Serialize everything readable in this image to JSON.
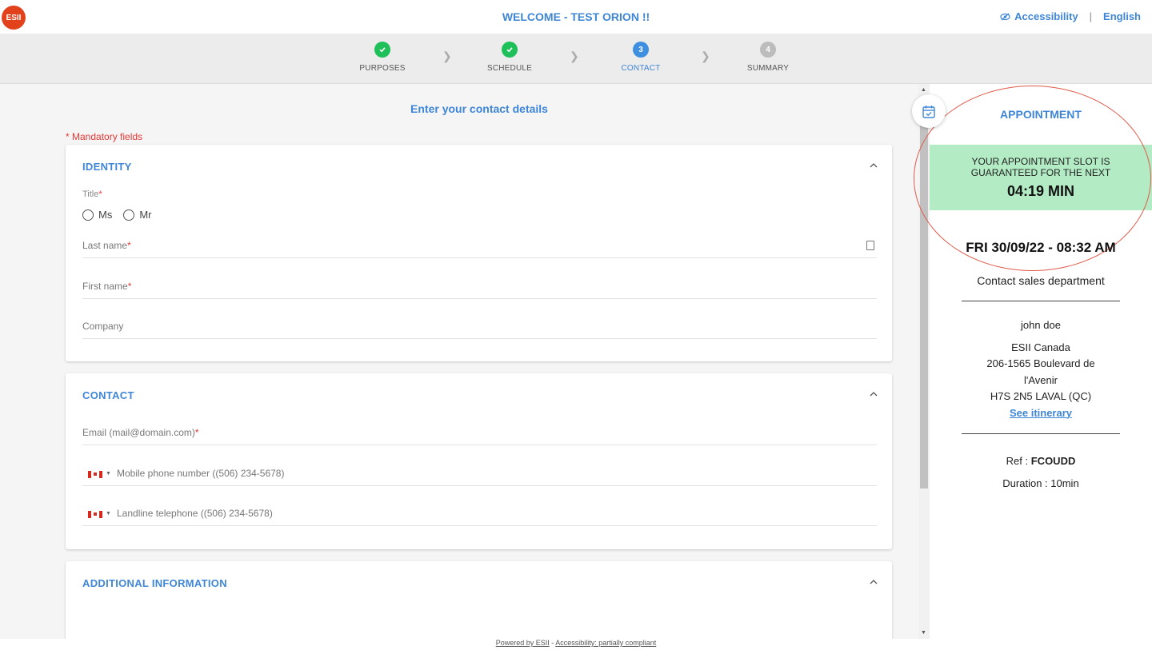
{
  "header": {
    "logo_text": "ESII",
    "welcome": "WELCOME - TEST ORION !!",
    "accessibility": "Accessibility",
    "separator": "|",
    "language": "English"
  },
  "stepper": {
    "steps": [
      {
        "label": "PURPOSES",
        "status": "done",
        "number": ""
      },
      {
        "label": "SCHEDULE",
        "status": "done",
        "number": ""
      },
      {
        "label": "CONTACT",
        "status": "active",
        "number": "3"
      },
      {
        "label": "SUMMARY",
        "status": "todo",
        "number": "4"
      }
    ],
    "colors": {
      "done": "#1fbf5a",
      "active": "#3f8fe0",
      "todo": "#bcbcbc"
    }
  },
  "form": {
    "title": "Enter your contact details",
    "mandatory_note": "* Mandatory fields",
    "identity": {
      "title": "IDENTITY",
      "title_field_label": "Title",
      "radio_options": [
        "Ms",
        "Mr"
      ],
      "last_name": "Last name",
      "first_name": "First name",
      "company": "Company"
    },
    "contact": {
      "title": "CONTACT",
      "email": "Email (mail@domain.com)",
      "mobile": "Mobile phone number ((506) 234-5678)",
      "landline": "Landline telephone ((506) 234-5678)"
    },
    "additional": {
      "title": "ADDITIONAL INFORMATION"
    },
    "required_mark": "*"
  },
  "appointment": {
    "title": "APPOINTMENT",
    "guarantee_text": "YOUR APPOINTMENT SLOT IS GUARANTEED FOR THE NEXT",
    "countdown": "04:19 MIN",
    "datetime": "FRI 30/09/22  -  08:32 AM",
    "department": "Contact sales department",
    "contact_name": "john doe",
    "company": "ESII Canada",
    "address_line1": "206-1565 Boulevard de",
    "address_line2": "l'Avenir",
    "address_line3": "H7S 2N5 LAVAL (QC)",
    "itinerary_link": "See itinerary",
    "ref_label": "Ref :",
    "ref_value": "FCOUDD",
    "duration": "Duration : 10min"
  },
  "footer": {
    "powered": "Powered by ESII",
    "dash": " - ",
    "accessibility": "Accessibility: partially compliant"
  }
}
